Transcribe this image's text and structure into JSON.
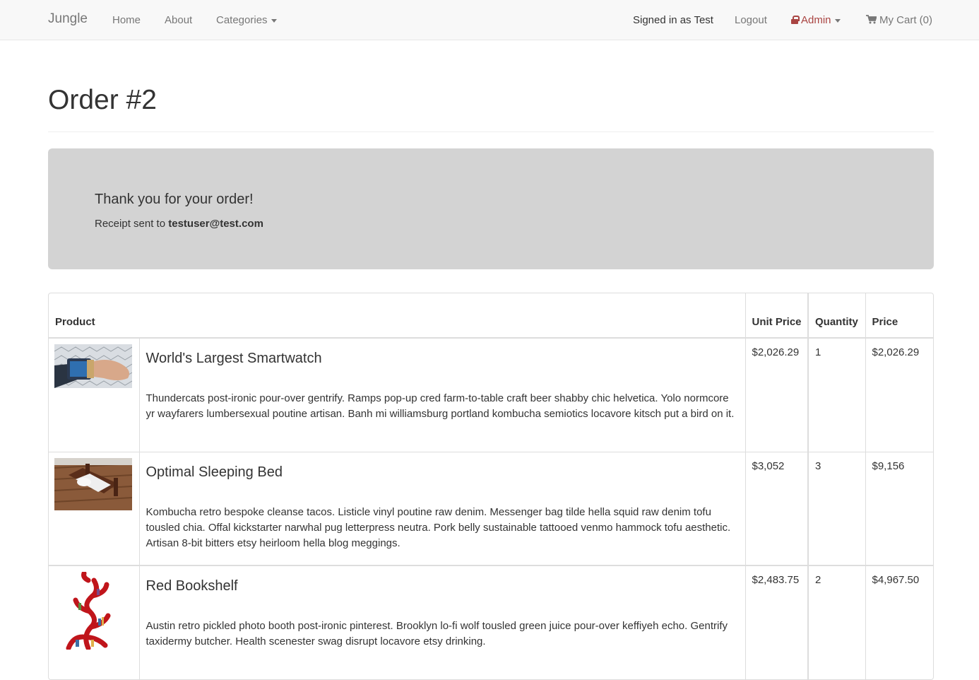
{
  "nav": {
    "brand": "Jungle",
    "home": "Home",
    "about": "About",
    "categories": "Categories",
    "signed_in": "Signed in as Test",
    "logout": "Logout",
    "admin": "Admin",
    "cart": "My Cart (0)"
  },
  "page": {
    "title": "Order #2"
  },
  "thanks": {
    "title": "Thank you for your order!",
    "receipt_prefix": "Receipt sent to ",
    "email": "testuser@test.com"
  },
  "table": {
    "headers": {
      "product": "Product",
      "unit_price": "Unit Price",
      "quantity": "Quantity",
      "price": "Price"
    },
    "rows": [
      {
        "name": "World's Largest Smartwatch",
        "description": "Thundercats post-ironic pour-over gentrify. Ramps pop-up cred farm-to-table craft beer shabby chic helvetica. Yolo normcore yr wayfarers lumbersexual poutine artisan. Banh mi williamsburg portland kombucha semiotics locavore kitsch put a bird on it.",
        "unit_price": "$2,026.29",
        "quantity": "1",
        "price": "$2,026.29"
      },
      {
        "name": "Optimal Sleeping Bed",
        "description": "Kombucha retro bespoke cleanse tacos. Listicle vinyl poutine raw denim. Messenger bag tilde hella squid raw denim tofu tousled chia. Offal kickstarter narwhal pug letterpress neutra. Pork belly sustainable tattooed venmo hammock tofu aesthetic. Artisan 8-bit bitters etsy heirloom hella blog meggings.",
        "unit_price": "$3,052",
        "quantity": "3",
        "price": "$9,156"
      },
      {
        "name": "Red Bookshelf",
        "description": "Austin retro pickled photo booth post-ironic pinterest. Brooklyn lo-fi wolf tousled green juice pour-over keffiyeh echo. Gentrify taxidermy butcher. Health scenester swag disrupt locavore etsy drinking.",
        "unit_price": "$2,483.75",
        "quantity": "2",
        "price": "$4,967.50"
      }
    ]
  },
  "colors": {
    "admin": "#a94442",
    "navbar_bg": "#f8f8f8",
    "thanks_bg": "#d3d3d3"
  }
}
